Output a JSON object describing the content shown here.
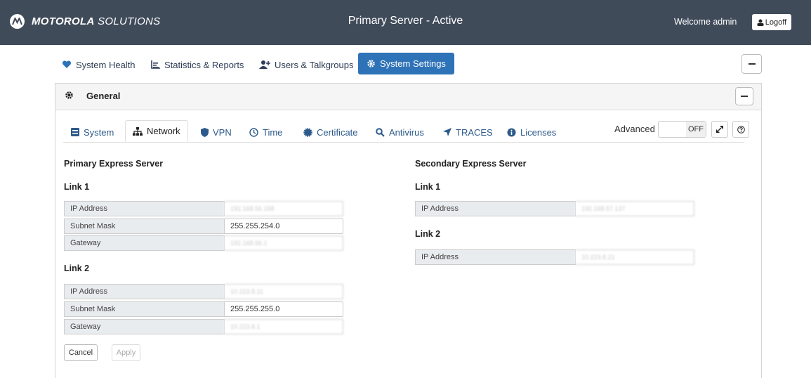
{
  "header": {
    "brand_bold": "MOTOROLA",
    "brand_light": "SOLUTIONS",
    "server_title": "Primary Server - Active",
    "welcome": "Welcome admin",
    "logoff": "Logoff"
  },
  "nav": {
    "tabs": [
      {
        "label": "System Health",
        "icon": "heart-icon"
      },
      {
        "label": "Statistics & Reports",
        "icon": "chart-icon"
      },
      {
        "label": "Users & Talkgroups",
        "icon": "user-plus-icon"
      },
      {
        "label": "System Settings",
        "icon": "gear-icon",
        "active": true
      }
    ]
  },
  "panel": {
    "title": "General"
  },
  "subtabs": [
    {
      "label": "System",
      "icon": "server-icon"
    },
    {
      "label": "Network",
      "icon": "network-icon",
      "active": true
    },
    {
      "label": "VPN",
      "icon": "shield-icon"
    },
    {
      "label": "Time",
      "icon": "clock-icon"
    },
    {
      "label": "Certificate",
      "icon": "certificate-icon"
    },
    {
      "label": "Antivirus",
      "icon": "search-icon"
    },
    {
      "label": "TRACES",
      "icon": "location-arrow-icon"
    },
    {
      "label": "Licenses",
      "icon": "info-icon"
    }
  ],
  "advanced": {
    "label": "Advanced",
    "toggle_state": "OFF"
  },
  "primary": {
    "heading": "Primary Express Server",
    "link1": {
      "heading": "Link 1",
      "ip_label": "IP Address",
      "ip_value": "192.168.56.158",
      "subnet_label": "Subnet Mask",
      "subnet_value": "255.255.254.0",
      "gateway_label": "Gateway",
      "gateway_value": "192.168.56.1"
    },
    "link2": {
      "heading": "Link 2",
      "ip_label": "IP Address",
      "ip_value": "10.223.8.11",
      "subnet_label": "Subnet Mask",
      "subnet_value": "255.255.255.0",
      "gateway_label": "Gateway",
      "gateway_value": "10.223.8.1"
    }
  },
  "secondary": {
    "heading": "Secondary Express Server",
    "link1": {
      "heading": "Link 1",
      "ip_label": "IP Address",
      "ip_value": "192.168.57.137"
    },
    "link2": {
      "heading": "Link 2",
      "ip_label": "IP Address",
      "ip_value": "10.223.8.21"
    }
  },
  "actions": {
    "cancel": "Cancel",
    "apply": "Apply"
  },
  "colors": {
    "header_bg": "#404b5a",
    "accent": "#2e72b7"
  }
}
